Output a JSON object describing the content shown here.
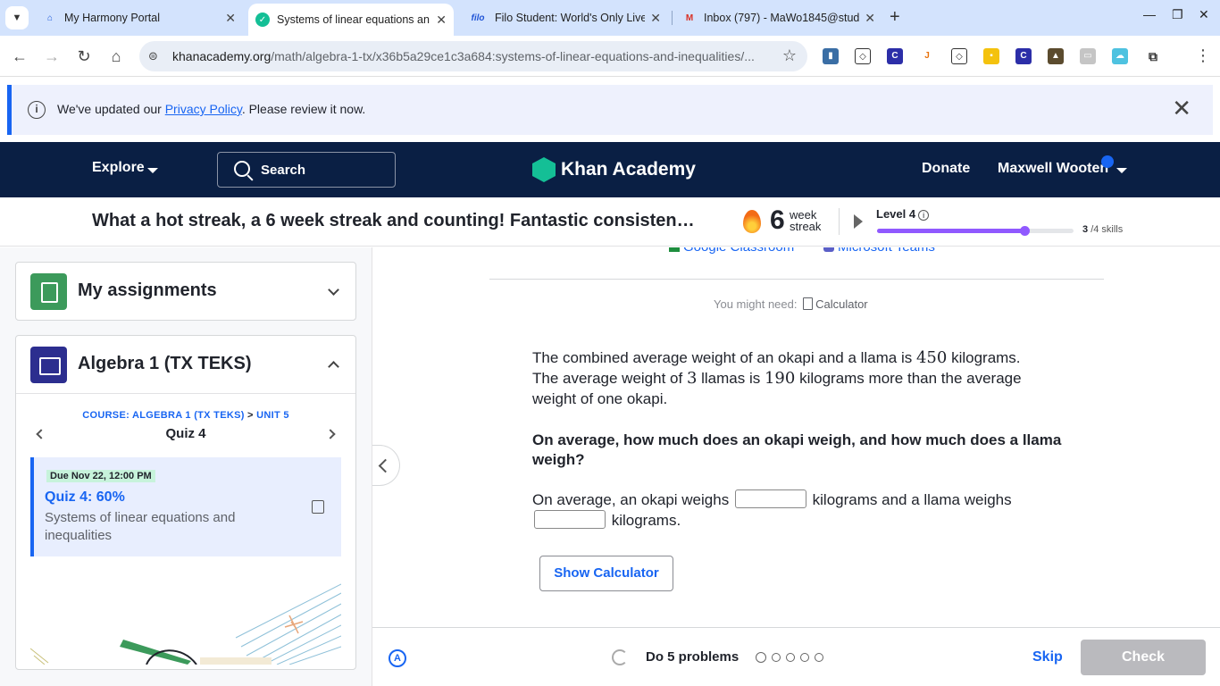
{
  "browser": {
    "tabs": [
      {
        "label": "My Harmony Portal",
        "favicon": "H",
        "favcolor": "#1a56db"
      },
      {
        "label": "Systems of linear equations an",
        "favicon": "K",
        "favcolor": "#14bf96"
      },
      {
        "label": "Filo Student: World's Only Live",
        "favicon": "filo",
        "favcolor": "#2155d6"
      },
      {
        "label": "Inbox (797) - MaWo1845@stud",
        "favicon": "M",
        "favcolor": "#d93025"
      }
    ],
    "url_domain": "khanacademy.org",
    "url_path": "/math/algebra-1-tx/x36b5a29ce1c3a684:systems-of-linear-equations-and-inequalities/..."
  },
  "banner": {
    "prefix": "We've updated our ",
    "link": "Privacy Policy",
    "suffix": ". Please review it now."
  },
  "nav": {
    "explore": "Explore",
    "search": "Search",
    "logo": "Khan Academy",
    "donate": "Donate",
    "user": "Maxwell Wooten"
  },
  "streak": {
    "message": "What a hot streak, a 6 week streak and counting! Fantastic consisten…",
    "count": "6",
    "unit_top": "week",
    "unit_bottom": "streak",
    "level": "Level 4",
    "level_progress": 0.75,
    "skills_done": "3",
    "skills_total": "/4 skills"
  },
  "sidebar": {
    "assignments_title": "My assignments",
    "course_title": "Algebra 1 (TX TEKS)",
    "crumb_course": "COURSE: ALGEBRA 1 (TX TEKS)",
    "crumb_gt": ">",
    "crumb_unit": "UNIT 5",
    "quiz_title": "Quiz 4",
    "item": {
      "due": "Due Nov 22, 12:00 PM",
      "score": "Quiz 4: 60%",
      "desc": "Systems of linear equations and inequalities"
    }
  },
  "main": {
    "share_gc": "Google Classroom",
    "share_mt": "Microsoft Teams",
    "need_label": "You might need:",
    "need_tool": "Calculator",
    "problem": {
      "p1": "The combined average weight of an okapi and a llama is ",
      "n1": "450",
      "p2": " kilograms. The average weight of ",
      "n2": "3",
      "p3": " llamas is ",
      "n3": "190",
      "p4": " kilograms more than the average weight of one okapi."
    },
    "question": "On average, how much does an okapi weigh, and how much does a llama weigh?",
    "answer_a": "On average, an okapi weighs ",
    "answer_b": " kilograms and a llama weighs ",
    "answer_c": " kilograms.",
    "show_calc": "Show Calculator"
  },
  "bottom": {
    "do_problems": "Do 5 problems",
    "skip": "Skip",
    "check": "Check"
  }
}
